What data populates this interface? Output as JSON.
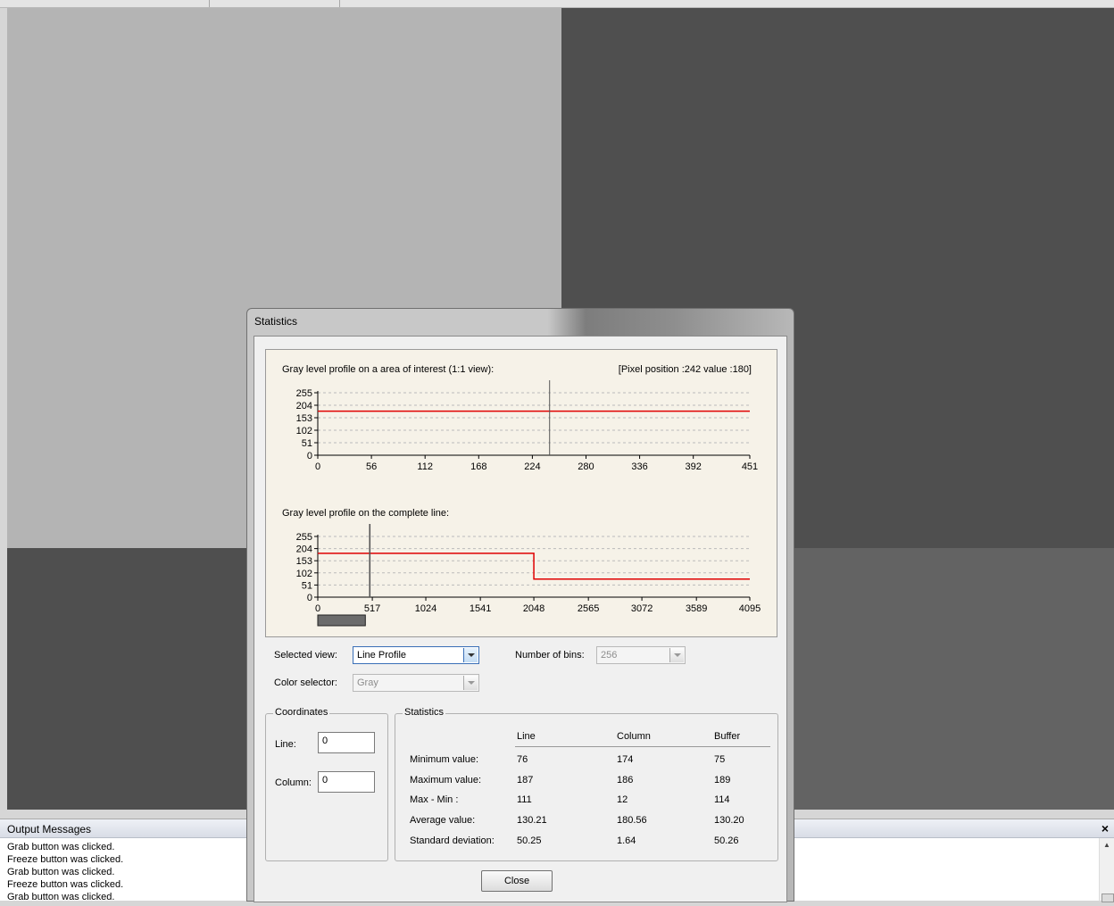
{
  "output": {
    "title": "Output Messages",
    "close_glyph": "×",
    "messages": [
      "Grab button was clicked.",
      "Freeze button was clicked.",
      "Grab button was clicked.",
      "Freeze button was clicked.",
      "Grab button was clicked."
    ]
  },
  "dialog": {
    "title": "Statistics",
    "roi_profile_label": "Gray level profile on a area of interest (1:1 view):",
    "pixel_info": "[Pixel position :242  value :180]",
    "line_profile_label": "Gray level profile on the complete line:",
    "selected_view_label": "Selected view:",
    "selected_view_value": "Line Profile",
    "bins_label": "Number of bins:",
    "bins_value": "256",
    "color_selector_label": "Color selector:",
    "color_selector_value": "Gray",
    "coordinates": {
      "title": "Coordinates",
      "line_label": "Line:",
      "line_value": "0",
      "column_label": "Column:",
      "column_value": "0"
    },
    "statistics": {
      "title": "Statistics",
      "columns": [
        "Line",
        "Column",
        "Buffer"
      ],
      "rows": [
        {
          "label": "Minimum value:",
          "values": [
            "76",
            "174",
            "75"
          ]
        },
        {
          "label": "Maximum value:",
          "values": [
            "187",
            "186",
            "189"
          ]
        },
        {
          "label": "Max - Min :",
          "values": [
            "111",
            "12",
            "114"
          ]
        },
        {
          "label": "Average value:",
          "values": [
            "130.21",
            "180.56",
            "130.20"
          ]
        },
        {
          "label": "Standard deviation:",
          "values": [
            "50.25",
            "1.64",
            "50.26"
          ]
        }
      ]
    },
    "close_label": "Close"
  },
  "chart_data": [
    {
      "type": "line",
      "title": "Gray level profile on a area of interest (1:1 view):",
      "xlim": [
        0,
        451
      ],
      "ylim": [
        0,
        255
      ],
      "x_ticks": [
        0,
        56,
        112,
        168,
        224,
        280,
        336,
        392,
        451
      ],
      "y_ticks": [
        0,
        51,
        102,
        153,
        204,
        255
      ],
      "series": [
        {
          "x": [
            0,
            451
          ],
          "y": [
            180,
            180
          ]
        }
      ],
      "cursor_x": 242,
      "grid": true
    },
    {
      "type": "line",
      "title": "Gray level profile on the complete line:",
      "xlim": [
        0,
        4095
      ],
      "ylim": [
        0,
        255
      ],
      "x_ticks": [
        0,
        517,
        1024,
        1541,
        2048,
        2565,
        3072,
        3589,
        4095
      ],
      "y_ticks": [
        0,
        51,
        102,
        153,
        204,
        255
      ],
      "series": [
        {
          "x": [
            0,
            2048,
            2048,
            4095
          ],
          "y": [
            184,
            184,
            76,
            76
          ]
        }
      ],
      "cursor_x": 493,
      "roi_range": [
        0,
        451
      ],
      "grid": true
    }
  ],
  "colors": {
    "signal": "#e00000",
    "chart_bg": "#f6f2e8",
    "image_light": "#b4b4b4",
    "image_dark": "#4f4f4f",
    "image_mid": "#636363"
  }
}
